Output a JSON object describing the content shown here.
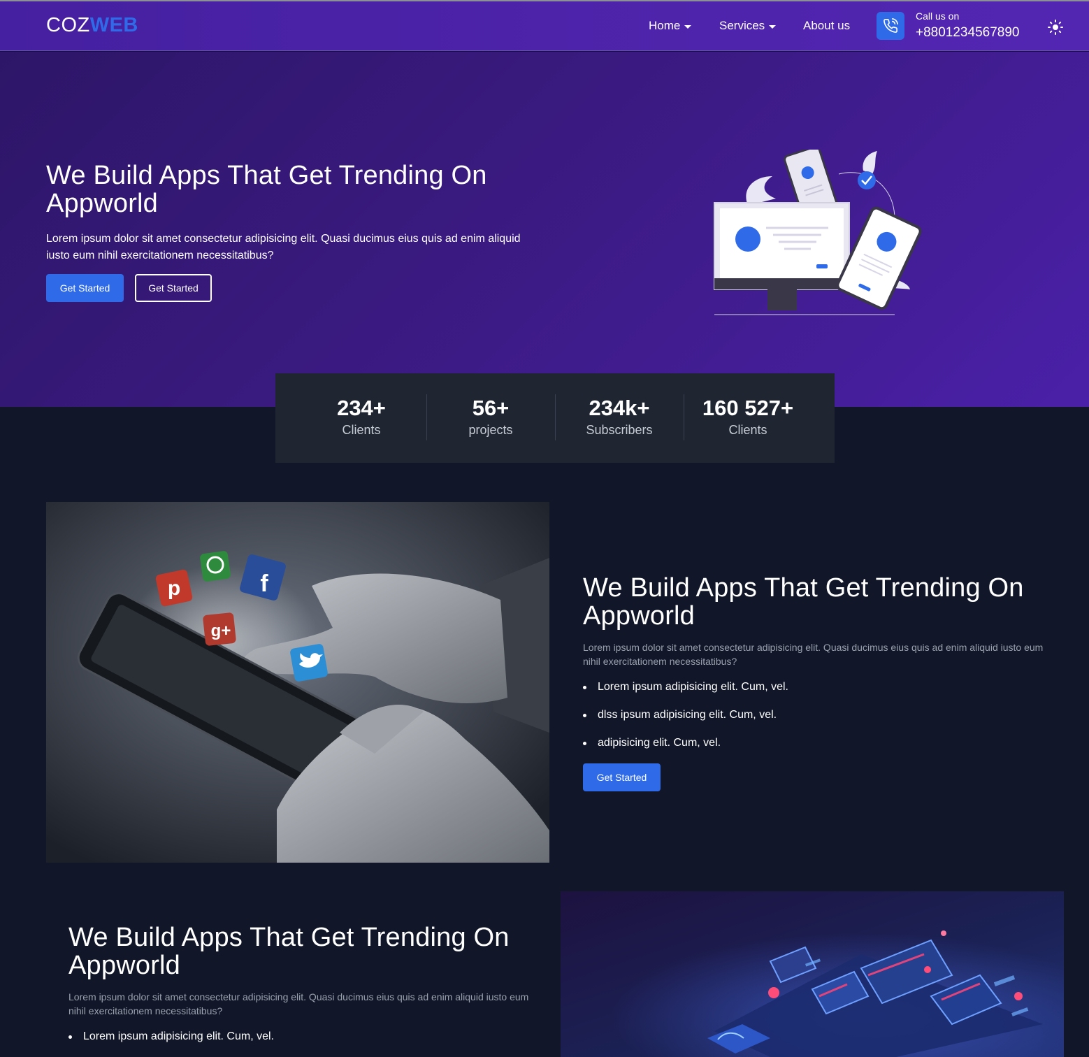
{
  "brand": {
    "logo_part1": "COZ",
    "logo_part2": "WEB"
  },
  "nav": {
    "items": [
      {
        "label": "Home",
        "dropdown": true
      },
      {
        "label": "Services",
        "dropdown": true
      },
      {
        "label": "About us",
        "dropdown": false
      }
    ],
    "call_label": "Call us on",
    "call_number": "+8801234567890"
  },
  "hero": {
    "title": "We Build Apps That Get Trending On Appworld",
    "text": "Lorem ipsum dolor sit amet consectetur adipisicing elit. Quasi ducimus eius quis ad enim aliquid iusto eum nihil exercitationem necessitatibus?",
    "btn_primary": "Get Started",
    "btn_outline": "Get Started"
  },
  "stats": [
    {
      "value": "234+",
      "label": "Clients"
    },
    {
      "value": "56+",
      "label": "projects"
    },
    {
      "value": "234k+",
      "label": "Subscribers"
    },
    {
      "value": "160 527+",
      "label": "Clients"
    }
  ],
  "feature1": {
    "title": "We Build Apps That Get Trending On Appworld",
    "text": "Lorem ipsum dolor sit amet consectetur adipisicing elit. Quasi ducimus eius quis ad enim aliquid iusto eum nihil exercitationem necessitatibus?",
    "bullets": [
      "Lorem ipsum adipisicing elit. Cum, vel.",
      "dlss ipsum adipisicing elit. Cum, vel.",
      "adipisicing elit. Cum, vel."
    ],
    "button": "Get Started"
  },
  "feature2": {
    "title": "We Build Apps That Get Trending On Appworld",
    "text": "Lorem ipsum dolor sit amet consectetur adipisicing elit. Quasi ducimus eius quis ad enim aliquid iusto eum nihil exercitationem necessitatibus?",
    "bullets": [
      "Lorem ipsum adipisicing elit. Cum, vel."
    ]
  },
  "colors": {
    "accent": "#2f6be8",
    "header_bg": "#4a23aa",
    "hero_bg": "#3a1a80",
    "page_bg": "#111729",
    "stats_bg": "#1f2632"
  },
  "icons": [
    "phone-call-icon",
    "sun-icon",
    "caret-down-icon"
  ]
}
